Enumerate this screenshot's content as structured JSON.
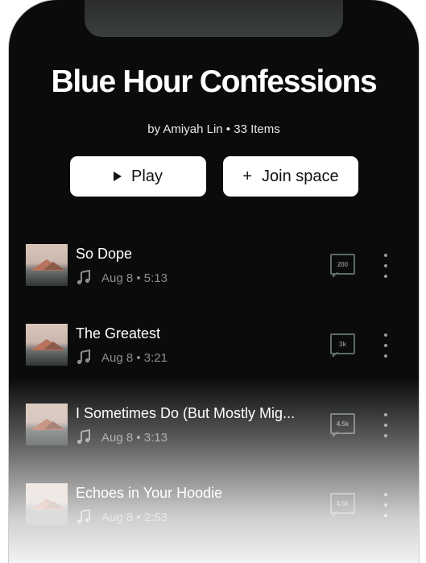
{
  "playlist": {
    "title": "Blue Hour Confessions",
    "meta": "by Amiyah Lin • 33 Items"
  },
  "actions": {
    "play_label": "Play",
    "join_label": "Join space"
  },
  "tracks": [
    {
      "name": "So Dope",
      "sub": "Aug 8 • 5:13",
      "comments": "200"
    },
    {
      "name": "The Greatest",
      "sub": "Aug 8 • 3:21",
      "comments": "3k"
    },
    {
      "name": "I Sometimes Do (But Mostly Mig...",
      "sub": "Aug 8 • 3:13",
      "comments": "4.5k"
    },
    {
      "name": "Echoes in Your Hoodie",
      "sub": "Aug 8 • 2:53",
      "comments": "4.5k"
    }
  ],
  "icons": {
    "play": "play-icon",
    "plus": "plus-icon",
    "note": "music-note-icon",
    "comment": "comment-icon",
    "more": "more-vertical-icon"
  },
  "colors": {
    "background": "#0b0b0b",
    "button": "#ffffff",
    "text_primary": "#ffffff",
    "text_secondary": "#8d8d8d"
  }
}
